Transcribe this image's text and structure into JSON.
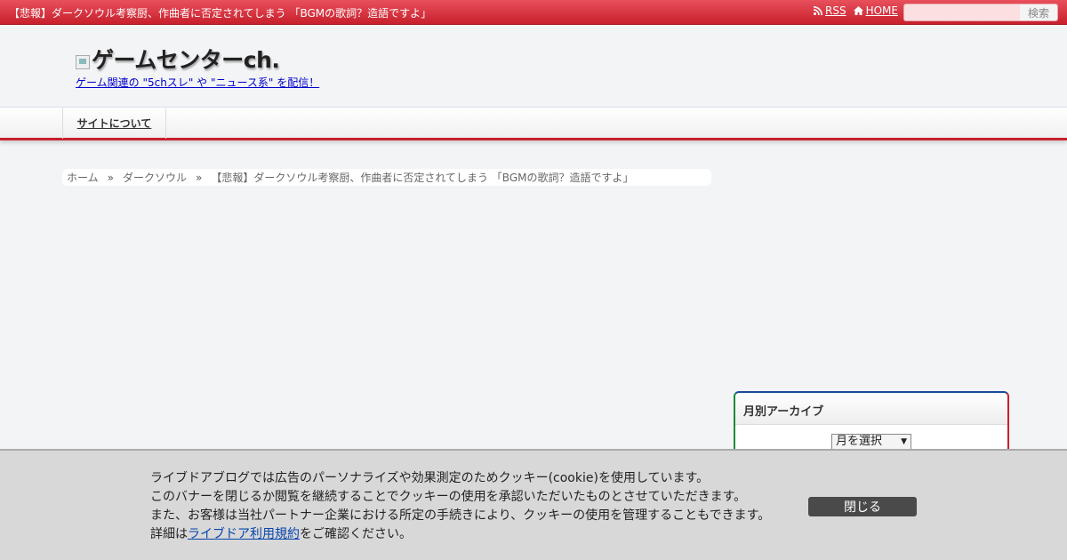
{
  "topbar": {
    "title": "【悲報】ダークソウル考察厨、作曲者に否定されてしまう 「BGMの歌詞？造語ですよ」",
    "rss_label": "RSS",
    "rss_icon": "rss-icon",
    "home_label": "HOME",
    "home_icon": "home-icon",
    "search_placeholder": "",
    "search_button": "検索",
    "accent_color": "#c8202c"
  },
  "header": {
    "site_title": "ゲームセンターch.",
    "site_description": "ゲーム関連の \"5chスレ\" や \"ニュース系\" を配信！"
  },
  "nav": {
    "items": [
      {
        "label": "サイトについて"
      }
    ]
  },
  "breadcrumb": {
    "items": [
      {
        "label": "ホーム"
      },
      {
        "label": "ダークソウル"
      },
      {
        "label": "【悲報】ダークソウル考察厨、作曲者に否定されてしまう 「BGMの歌詞？造語ですよ」"
      }
    ],
    "separator": "»"
  },
  "sidebar": {
    "archive_title": "月別アーカイブ",
    "archive_select": "月を選択"
  },
  "cookie_banner": {
    "line1": "ライブドアブログでは広告のパーソナライズや効果測定のためクッキー(cookie)を使用しています。",
    "line2": "このバナーを閉じるか閲覧を継続することでクッキーの使用を承認いただいたものとさせていただきます。",
    "line3": "また、お客様は当社パートナー企業における所定の手続きにより、クッキーの使用を管理することもできます。",
    "line4_prefix": "詳細は",
    "line4_link": "ライブドア利用規約",
    "line4_suffix": "をご確認ください。",
    "close_button": "閉じる"
  }
}
